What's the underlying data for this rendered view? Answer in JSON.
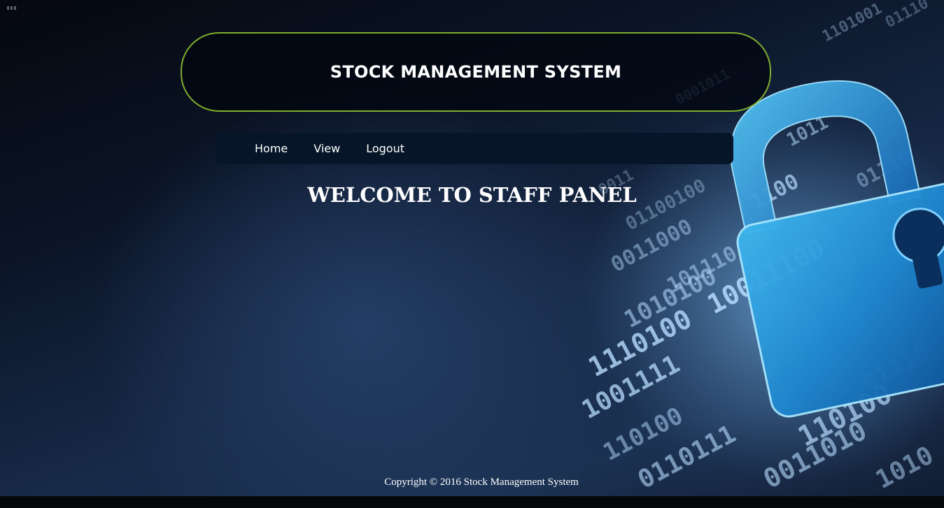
{
  "header": {
    "title": "STOCK MANAGEMENT SYSTEM"
  },
  "nav": {
    "items": [
      {
        "label": "Home"
      },
      {
        "label": "View"
      },
      {
        "label": "Logout"
      }
    ]
  },
  "main": {
    "heading": "WELCOME TO STAFF PANEL"
  },
  "footer": {
    "copyright": "Copyright © 2016 Stock Management System"
  },
  "colors": {
    "header_border": "#7fae2e",
    "nav_background": "#061628",
    "lock_blue": "#29a3e0"
  },
  "background_image": {
    "icon": "padlock-binary-icon",
    "binary_text": [
      "1101001",
      "01110",
      "0001011",
      "1011",
      "0011000",
      "01100100",
      "1100",
      "0011",
      "1110100",
      "1001111",
      "1010100",
      "0110111",
      "10011100",
      "110100",
      "01110",
      "0011010",
      "110100",
      "101110",
      "1010",
      "01110"
    ]
  }
}
